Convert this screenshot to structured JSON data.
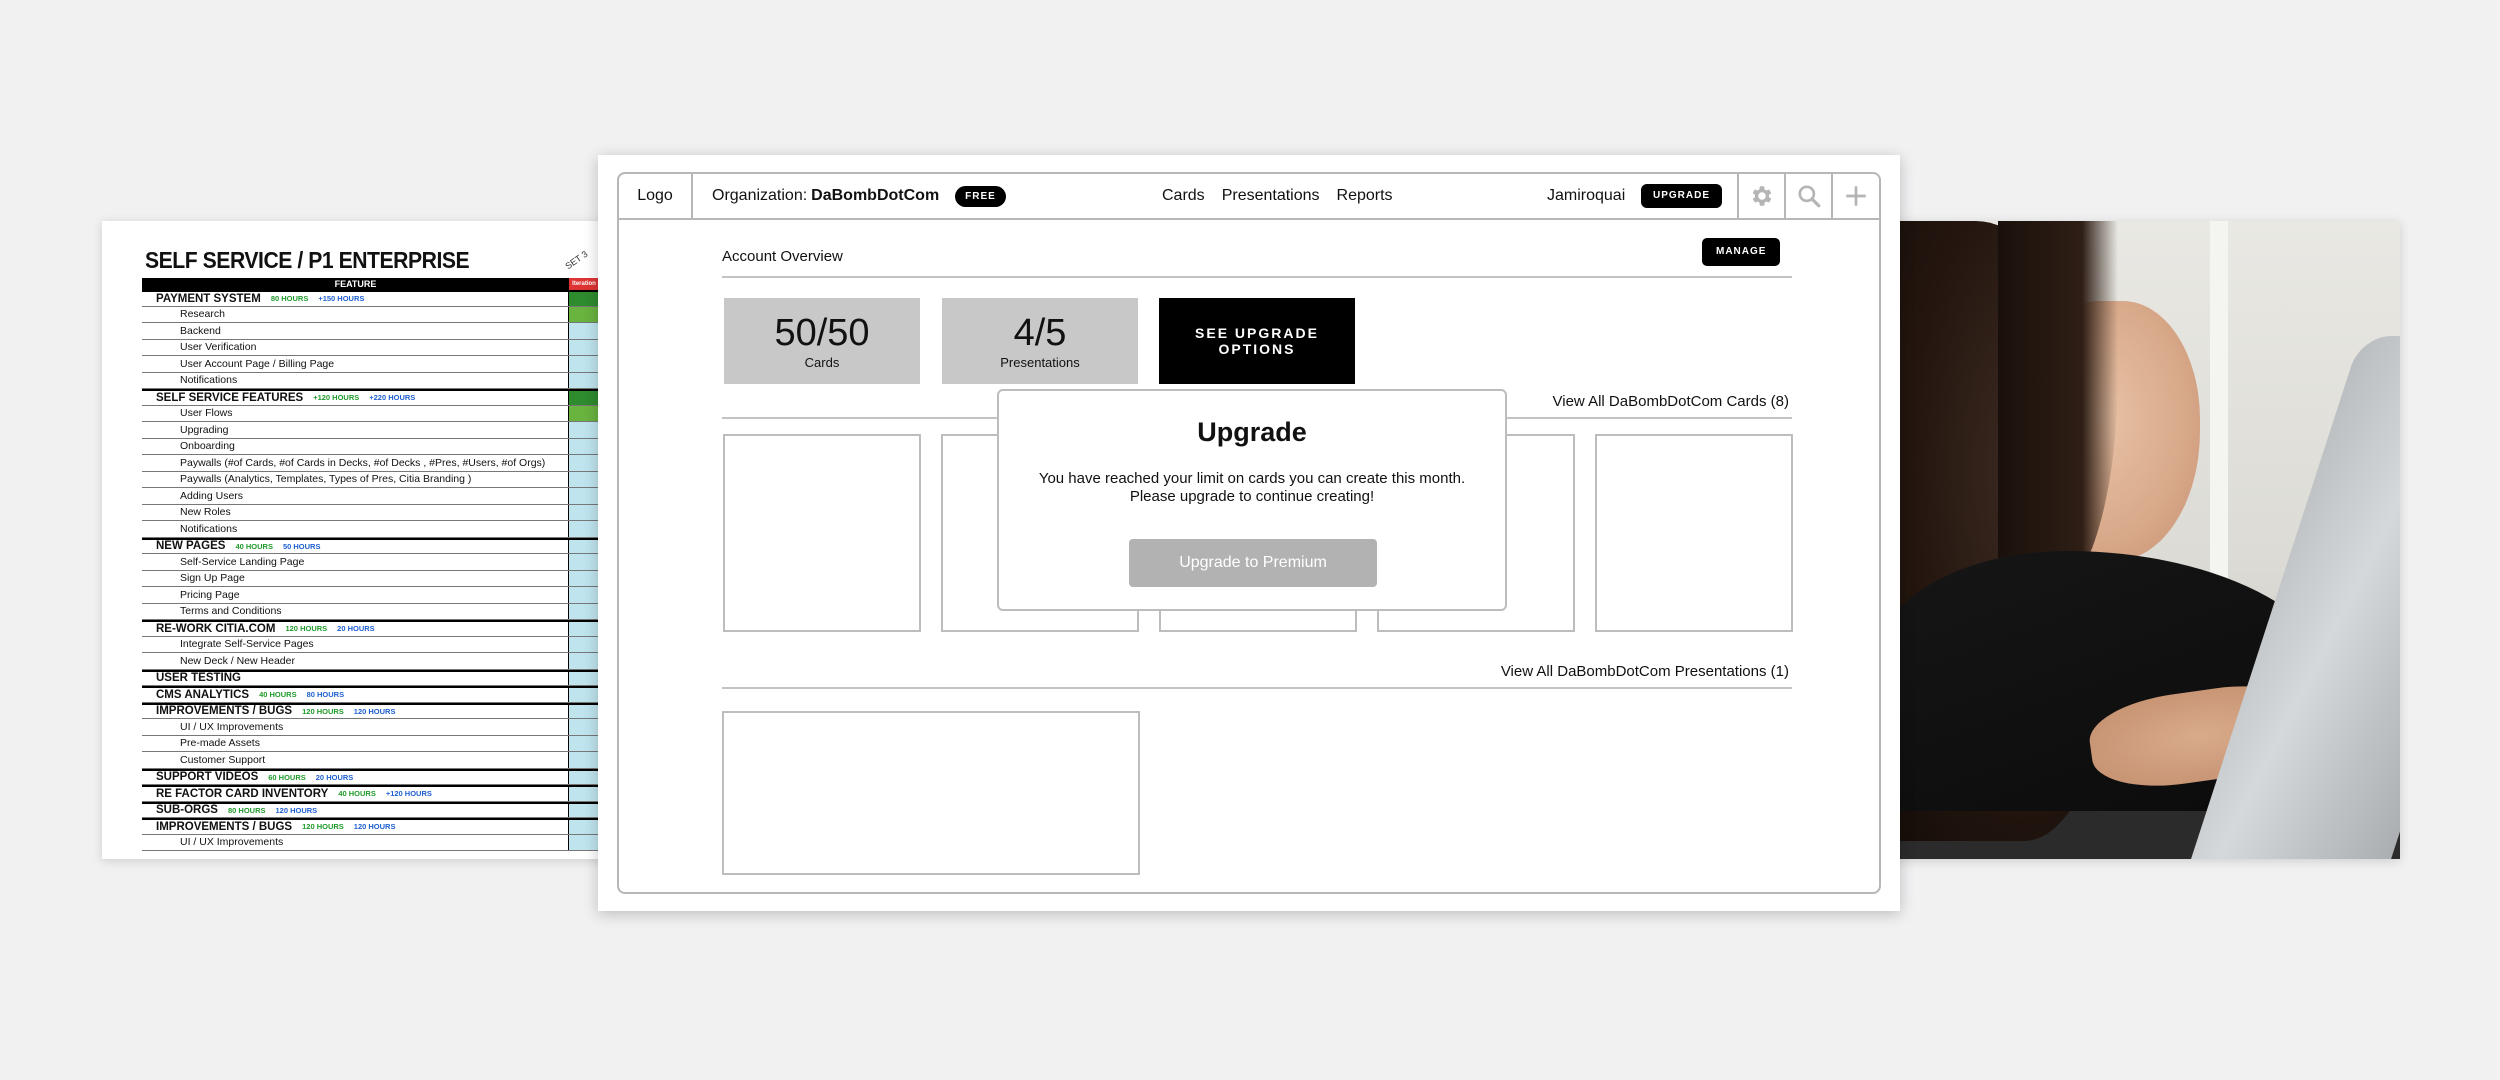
{
  "sheet": {
    "title": "SELF SERVICE / P1 ENTERPRISE",
    "mark": "SET 3",
    "header": "FEATURE",
    "header_col": "Iteration",
    "rows": [
      {
        "type": "section",
        "text": "PAYMENT SYSTEM",
        "h1": "80 HOURS",
        "h2": "+150 HOURS",
        "col": "g-dark"
      },
      {
        "type": "item",
        "text": "Research",
        "col": "g-light"
      },
      {
        "type": "item",
        "text": "Backend"
      },
      {
        "type": "item",
        "text": "User Verification"
      },
      {
        "type": "item",
        "text": "User Account Page / Billing Page"
      },
      {
        "type": "item",
        "text": "Notifications"
      },
      {
        "type": "section",
        "text": "SELF SERVICE FEATURES",
        "h1": "+120 HOURS",
        "h2": "+220 HOURS",
        "col": "g-dark"
      },
      {
        "type": "item",
        "text": "User Flows",
        "col": "g-light"
      },
      {
        "type": "item",
        "text": "Upgrading"
      },
      {
        "type": "item",
        "text": "Onboarding"
      },
      {
        "type": "item",
        "text": "Paywalls (#of Cards, #of Cards in Decks, #of Decks , #Pres, #Users, #of Orgs)"
      },
      {
        "type": "item",
        "text": "Paywalls (Analytics, Templates, Types of Pres, Citia Branding )"
      },
      {
        "type": "item",
        "text": "Adding Users"
      },
      {
        "type": "item",
        "text": "New Roles"
      },
      {
        "type": "item",
        "text": "Notifications"
      },
      {
        "type": "section",
        "text": "NEW PAGES",
        "h1": "40 HOURS",
        "h2": "50 HOURS"
      },
      {
        "type": "item",
        "text": "Self-Service Landing Page"
      },
      {
        "type": "item",
        "text": "Sign Up Page"
      },
      {
        "type": "item",
        "text": "Pricing Page"
      },
      {
        "type": "item",
        "text": "Terms and Conditions"
      },
      {
        "type": "section",
        "text": "RE-WORK CITIA.COM",
        "h1": "120 HOURS",
        "h2": "20 HOURS"
      },
      {
        "type": "item",
        "text": "Integrate Self-Service Pages"
      },
      {
        "type": "item",
        "text": "New Deck / New Header"
      },
      {
        "type": "section",
        "text": "USER TESTING"
      },
      {
        "type": "section",
        "text": "CMS ANALYTICS",
        "h1": "40 HOURS",
        "h2": "80 HOURS"
      },
      {
        "type": "section",
        "text": "IMPROVEMENTS / BUGS",
        "h1": "120 HOURS",
        "h2": "120 HOURS"
      },
      {
        "type": "item",
        "text": "UI / UX Improvements"
      },
      {
        "type": "item",
        "text": "Pre-made Assets"
      },
      {
        "type": "item",
        "text": "Customer Support"
      },
      {
        "type": "section",
        "text": "SUPPORT VIDEOS",
        "h1": "60 HOURS",
        "h2": "20 HOURS"
      },
      {
        "type": "section",
        "text": "RE FACTOR CARD INVENTORY",
        "h1": "40 HOURS",
        "h2": "+120 HOURS"
      },
      {
        "type": "section",
        "text": "SUB-ORGS",
        "h1": "80 HOURS",
        "h2": "120 HOURS"
      },
      {
        "type": "section",
        "text": "IMPROVEMENTS / BUGS",
        "h1": "120 HOURS",
        "h2": "120 HOURS"
      },
      {
        "type": "item",
        "text": "UI / UX Improvements"
      }
    ]
  },
  "app": {
    "logo": "Logo",
    "org_label": "Organization:",
    "org_name": "DaBombDotCom",
    "plan_badge": "FREE",
    "nav": [
      "Cards",
      "Presentations",
      "Reports"
    ],
    "user": "Jamiroquai",
    "upgrade_button": "UPGRADE",
    "icons": [
      "gear-icon",
      "search-icon",
      "plus-icon"
    ]
  },
  "overview": {
    "title": "Account Overview",
    "manage_button": "MANAGE",
    "cards_stat": {
      "value": "50/50",
      "label": "Cards"
    },
    "pres_stat": {
      "value": "4/5",
      "label": "Presentations"
    },
    "upgrade_options": "SEE UPGRADE OPTIONS",
    "view_cards": "View All DaBombDotCom Cards (8)",
    "view_presentations": "View All DaBombDotCom Presentations (1)"
  },
  "modal": {
    "title": "Upgrade",
    "message_line1": "You have reached your limit on cards you can create this month.",
    "message_line2": "Please upgrade to continue creating!",
    "button": "Upgrade to Premium"
  },
  "colors": {
    "accent_black": "#000000",
    "stat_gray": "#c8c8c8",
    "border_gray": "#b7b7b7",
    "disabled_button": "#b2b2b2"
  }
}
